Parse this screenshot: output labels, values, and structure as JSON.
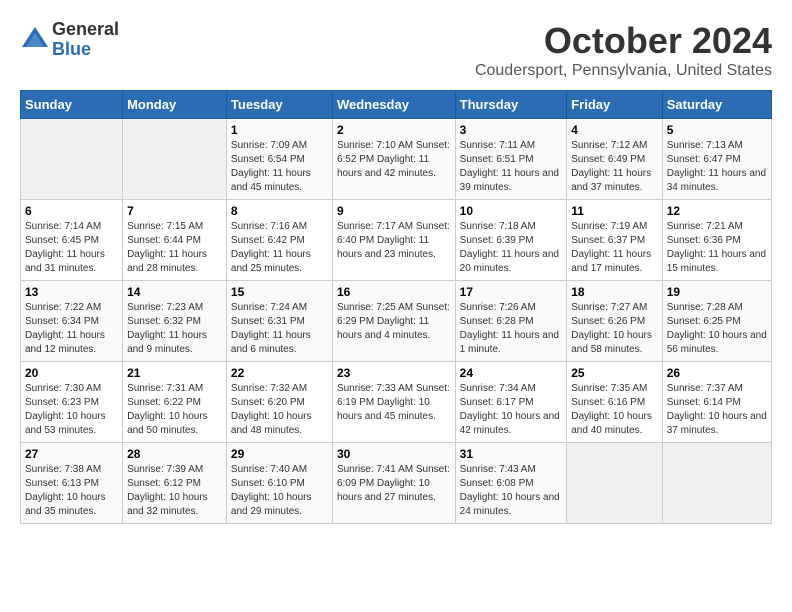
{
  "logo": {
    "general": "General",
    "blue": "Blue"
  },
  "title": "October 2024",
  "subtitle": "Coudersport, Pennsylvania, United States",
  "days_of_week": [
    "Sunday",
    "Monday",
    "Tuesday",
    "Wednesday",
    "Thursday",
    "Friday",
    "Saturday"
  ],
  "weeks": [
    [
      {
        "day": "",
        "info": ""
      },
      {
        "day": "",
        "info": ""
      },
      {
        "day": "1",
        "info": "Sunrise: 7:09 AM\nSunset: 6:54 PM\nDaylight: 11 hours and 45 minutes."
      },
      {
        "day": "2",
        "info": "Sunrise: 7:10 AM\nSunset: 6:52 PM\nDaylight: 11 hours and 42 minutes."
      },
      {
        "day": "3",
        "info": "Sunrise: 7:11 AM\nSunset: 6:51 PM\nDaylight: 11 hours and 39 minutes."
      },
      {
        "day": "4",
        "info": "Sunrise: 7:12 AM\nSunset: 6:49 PM\nDaylight: 11 hours and 37 minutes."
      },
      {
        "day": "5",
        "info": "Sunrise: 7:13 AM\nSunset: 6:47 PM\nDaylight: 11 hours and 34 minutes."
      }
    ],
    [
      {
        "day": "6",
        "info": "Sunrise: 7:14 AM\nSunset: 6:45 PM\nDaylight: 11 hours and 31 minutes."
      },
      {
        "day": "7",
        "info": "Sunrise: 7:15 AM\nSunset: 6:44 PM\nDaylight: 11 hours and 28 minutes."
      },
      {
        "day": "8",
        "info": "Sunrise: 7:16 AM\nSunset: 6:42 PM\nDaylight: 11 hours and 25 minutes."
      },
      {
        "day": "9",
        "info": "Sunrise: 7:17 AM\nSunset: 6:40 PM\nDaylight: 11 hours and 23 minutes."
      },
      {
        "day": "10",
        "info": "Sunrise: 7:18 AM\nSunset: 6:39 PM\nDaylight: 11 hours and 20 minutes."
      },
      {
        "day": "11",
        "info": "Sunrise: 7:19 AM\nSunset: 6:37 PM\nDaylight: 11 hours and 17 minutes."
      },
      {
        "day": "12",
        "info": "Sunrise: 7:21 AM\nSunset: 6:36 PM\nDaylight: 11 hours and 15 minutes."
      }
    ],
    [
      {
        "day": "13",
        "info": "Sunrise: 7:22 AM\nSunset: 6:34 PM\nDaylight: 11 hours and 12 minutes."
      },
      {
        "day": "14",
        "info": "Sunrise: 7:23 AM\nSunset: 6:32 PM\nDaylight: 11 hours and 9 minutes."
      },
      {
        "day": "15",
        "info": "Sunrise: 7:24 AM\nSunset: 6:31 PM\nDaylight: 11 hours and 6 minutes."
      },
      {
        "day": "16",
        "info": "Sunrise: 7:25 AM\nSunset: 6:29 PM\nDaylight: 11 hours and 4 minutes."
      },
      {
        "day": "17",
        "info": "Sunrise: 7:26 AM\nSunset: 6:28 PM\nDaylight: 11 hours and 1 minute."
      },
      {
        "day": "18",
        "info": "Sunrise: 7:27 AM\nSunset: 6:26 PM\nDaylight: 10 hours and 58 minutes."
      },
      {
        "day": "19",
        "info": "Sunrise: 7:28 AM\nSunset: 6:25 PM\nDaylight: 10 hours and 56 minutes."
      }
    ],
    [
      {
        "day": "20",
        "info": "Sunrise: 7:30 AM\nSunset: 6:23 PM\nDaylight: 10 hours and 53 minutes."
      },
      {
        "day": "21",
        "info": "Sunrise: 7:31 AM\nSunset: 6:22 PM\nDaylight: 10 hours and 50 minutes."
      },
      {
        "day": "22",
        "info": "Sunrise: 7:32 AM\nSunset: 6:20 PM\nDaylight: 10 hours and 48 minutes."
      },
      {
        "day": "23",
        "info": "Sunrise: 7:33 AM\nSunset: 6:19 PM\nDaylight: 10 hours and 45 minutes."
      },
      {
        "day": "24",
        "info": "Sunrise: 7:34 AM\nSunset: 6:17 PM\nDaylight: 10 hours and 42 minutes."
      },
      {
        "day": "25",
        "info": "Sunrise: 7:35 AM\nSunset: 6:16 PM\nDaylight: 10 hours and 40 minutes."
      },
      {
        "day": "26",
        "info": "Sunrise: 7:37 AM\nSunset: 6:14 PM\nDaylight: 10 hours and 37 minutes."
      }
    ],
    [
      {
        "day": "27",
        "info": "Sunrise: 7:38 AM\nSunset: 6:13 PM\nDaylight: 10 hours and 35 minutes."
      },
      {
        "day": "28",
        "info": "Sunrise: 7:39 AM\nSunset: 6:12 PM\nDaylight: 10 hours and 32 minutes."
      },
      {
        "day": "29",
        "info": "Sunrise: 7:40 AM\nSunset: 6:10 PM\nDaylight: 10 hours and 29 minutes."
      },
      {
        "day": "30",
        "info": "Sunrise: 7:41 AM\nSunset: 6:09 PM\nDaylight: 10 hours and 27 minutes."
      },
      {
        "day": "31",
        "info": "Sunrise: 7:43 AM\nSunset: 6:08 PM\nDaylight: 10 hours and 24 minutes."
      },
      {
        "day": "",
        "info": ""
      },
      {
        "day": "",
        "info": ""
      }
    ]
  ]
}
